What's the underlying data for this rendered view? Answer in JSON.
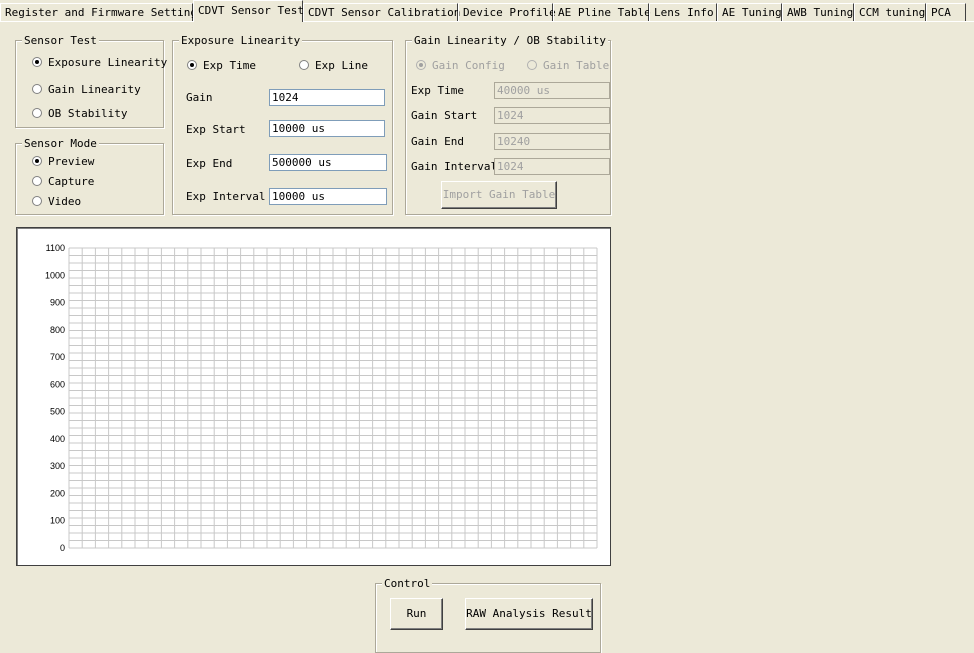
{
  "tabs": [
    {
      "label": "Register and Firmware Settings",
      "active": false
    },
    {
      "label": "CDVT Sensor Test",
      "active": true
    },
    {
      "label": "CDVT Sensor Calibration",
      "active": false
    },
    {
      "label": "Device Profile",
      "active": false
    },
    {
      "label": "AE Pline Table",
      "active": false
    },
    {
      "label": "Lens Info",
      "active": false
    },
    {
      "label": "AE Tuning",
      "active": false
    },
    {
      "label": "AWB Tuning",
      "active": false
    },
    {
      "label": "CCM tuning",
      "active": false
    },
    {
      "label": "PCA",
      "active": false
    }
  ],
  "sensor_test": {
    "title": "Sensor Test",
    "options": [
      {
        "label": "Exposure Linearity",
        "checked": true
      },
      {
        "label": "Gain Linearity",
        "checked": false
      },
      {
        "label": "OB Stability",
        "checked": false
      }
    ]
  },
  "sensor_mode": {
    "title": "Sensor Mode",
    "options": [
      {
        "label": "Preview",
        "checked": true
      },
      {
        "label": "Capture",
        "checked": false
      },
      {
        "label": "Video",
        "checked": false
      }
    ]
  },
  "exposure_linearity": {
    "title": "Exposure Linearity",
    "exp_time_label": "Exp Time",
    "exp_line_label": "Exp Line",
    "gain_label": "Gain",
    "gain_value": "1024",
    "exp_start_label": "Exp Start",
    "exp_start_value": "10000 us",
    "exp_end_label": "Exp End",
    "exp_end_value": "500000 us",
    "exp_interval_label": "Exp Interval",
    "exp_interval_value": "10000 us"
  },
  "gain_linearity": {
    "title": "Gain Linearity / OB Stability",
    "gain_config_label": "Gain Config",
    "gain_table_label": "Gain Table",
    "exp_time_label": "Exp Time",
    "exp_time_value": "40000 us",
    "gain_start_label": "Gain Start",
    "gain_start_value": "1024",
    "gain_end_label": "Gain End",
    "gain_end_value": "10240",
    "gain_interval_label": "Gain Interval",
    "gain_interval_value": "1024",
    "import_button": "Import Gain Table"
  },
  "chart_data": {
    "type": "line",
    "y_ticks": [
      "1100",
      "1000",
      "900",
      "800",
      "700",
      "600",
      "500",
      "400",
      "300",
      "200",
      "100",
      "0"
    ],
    "ylim": [
      0,
      1100
    ],
    "grid": true,
    "series": []
  },
  "control": {
    "title": "Control",
    "run_button": "Run",
    "raw_button": "RAW Analysis Result"
  }
}
